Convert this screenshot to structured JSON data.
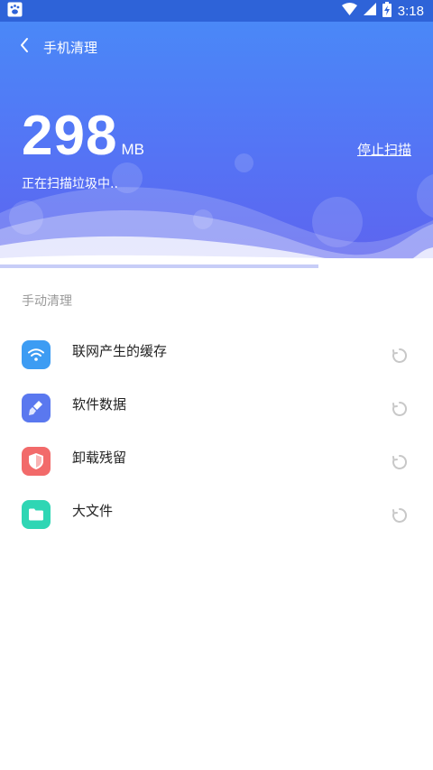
{
  "status_bar": {
    "time": "3:18",
    "icons": [
      "baidu-paw-icon",
      "wifi-icon",
      "signal-icon",
      "battery-charging-icon"
    ]
  },
  "header": {
    "title": "手机清理",
    "size_value": "298",
    "size_unit": "MB",
    "stop_label": "停止扫描",
    "scan_status": "正在扫描垃圾中.."
  },
  "progress": {
    "fraction": 0.735
  },
  "section": {
    "label": "手动清理"
  },
  "items": [
    {
      "label": "联网产生的缓存",
      "icon": "wifi-icon",
      "color": "#3d9cf3"
    },
    {
      "label": "软件数据",
      "icon": "broom-icon",
      "color": "#5a78ef"
    },
    {
      "label": "卸载残留",
      "icon": "shield-icon",
      "color": "#f26a6a"
    },
    {
      "label": "大文件",
      "icon": "folder-icon",
      "color": "#2fd6b4"
    }
  ],
  "colors": {
    "status_bar": "#2e63d8",
    "header_top": "#4a88f7",
    "header_bottom": "#5e63ef",
    "spinner": "#c8c8c8"
  }
}
